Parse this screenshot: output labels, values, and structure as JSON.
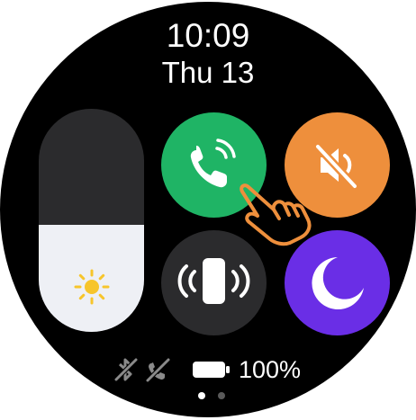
{
  "clock": {
    "time": "10:09",
    "date": "Thu 13"
  },
  "brightness": {
    "level": 0.48,
    "icon": "sun-icon"
  },
  "tiles": [
    {
      "name": "call-toggle",
      "icon": "phone-call-icon",
      "color": "#1fb465"
    },
    {
      "name": "mute-toggle",
      "icon": "speaker-mute-icon",
      "color": "#ee8f3c"
    },
    {
      "name": "vibrate-toggle",
      "icon": "phone-vibrate-icon",
      "color": "#2b2b2d"
    },
    {
      "name": "dnd-toggle",
      "icon": "moon-icon",
      "color": "#6a2ee6"
    }
  ],
  "status": {
    "icons": [
      "bluetooth-off-icon",
      "phone-off-icon",
      "battery-icon"
    ],
    "battery": "100%"
  },
  "pager": {
    "pages": 2,
    "active": 1
  }
}
